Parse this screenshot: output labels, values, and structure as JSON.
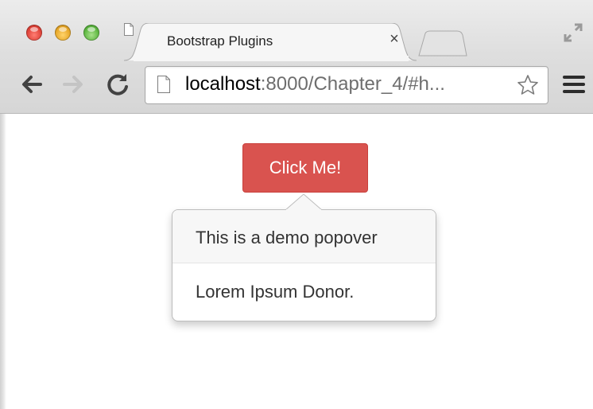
{
  "window": {
    "traffic_lights": [
      "close",
      "minimize",
      "zoom"
    ]
  },
  "tab": {
    "title": "Bootstrap Plugins",
    "close_label": "×",
    "icon": "page-icon"
  },
  "toolbar": {
    "back_icon": "arrow-left-icon",
    "forward_icon": "arrow-right-icon",
    "reload_icon": "reload-icon",
    "menu_icon": "hamburger-icon"
  },
  "address_bar": {
    "host": "localhost",
    "rest": ":8000/Chapter_4/#h...",
    "bookmark_icon": "star-icon"
  },
  "page": {
    "button_label": "Click Me!",
    "button_color": "#d9534f",
    "popover": {
      "title": "This is a demo popover",
      "content": "Lorem Ipsum Donor."
    }
  }
}
